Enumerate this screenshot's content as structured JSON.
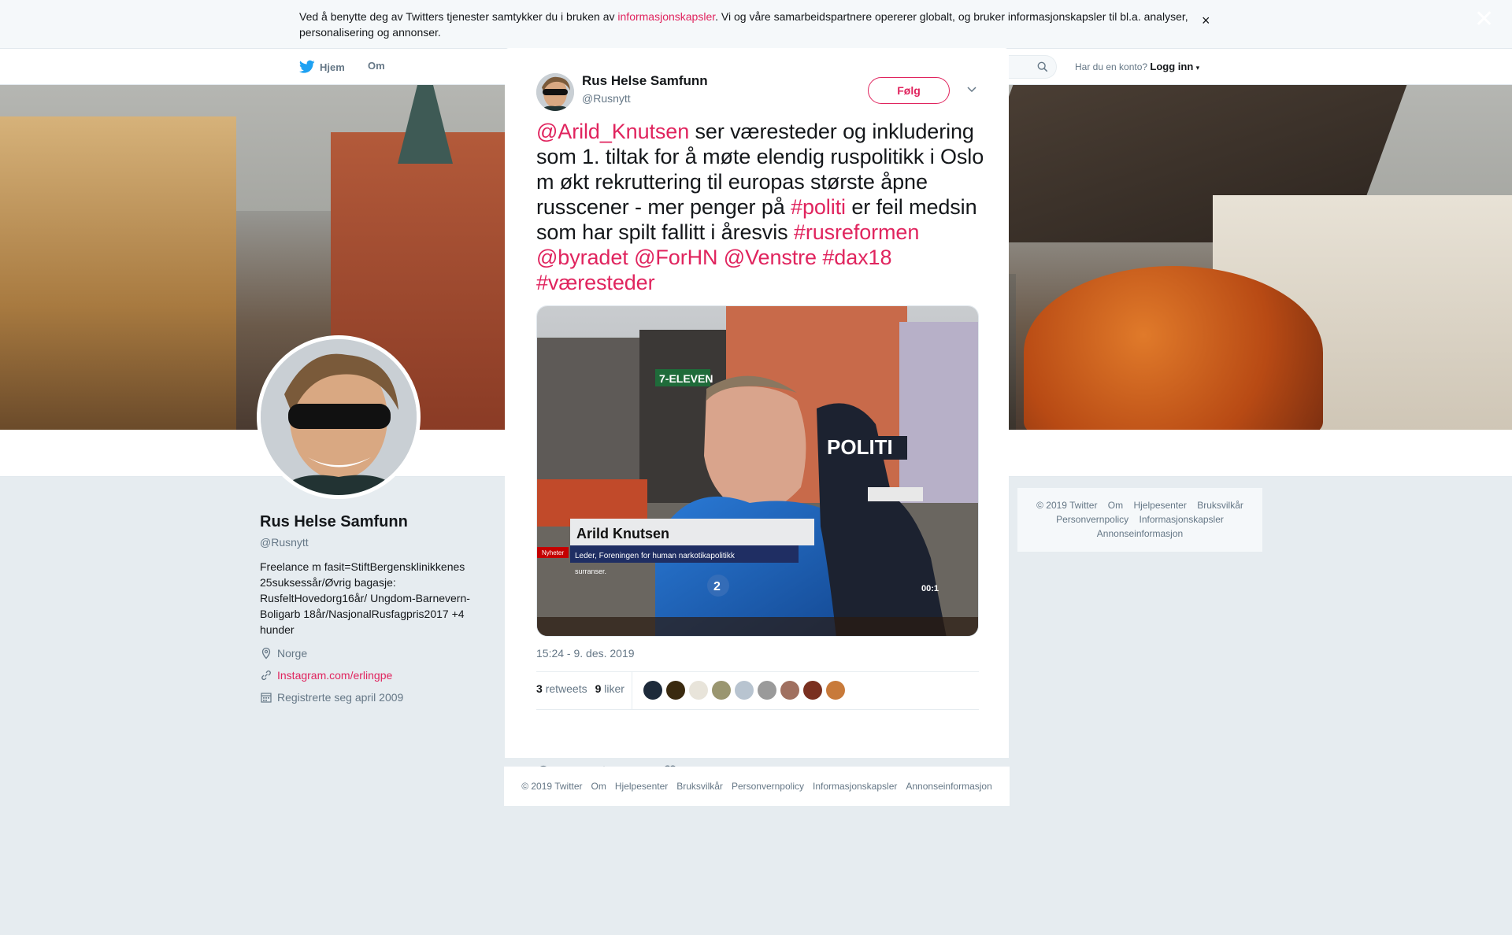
{
  "cookie_banner": {
    "text_before": "Ved å benytte deg av Twitters tjenester samtykker du i bruken av ",
    "link": "informasjonskapsler",
    "text_after": ". Vi og våre samarbeidspartnere opererer globalt, og bruker informasjonskapsler til bl.a. analyser, personalisering og annonser.",
    "close": "×"
  },
  "global_close": "✕",
  "nav": {
    "home": "Hjem",
    "about": "Om",
    "account_prompt": "Har du en konto?",
    "login": "Logg inn"
  },
  "profile": {
    "name": "Rus Helse Samfunn",
    "handle": "@Rusnytt",
    "bio": "Freelance m fasit=StiftBergensklinikkenes 25suksessår/Øvrig bagasje: RusfeltHovedorg16år/ Ungdom-Barnevern-Boligarb 18år/NasjonalRusfagpris2017 +4 hunder",
    "location": "Norge",
    "website": "Instagram.com/erlingpe",
    "joined": "Registrerte seg april 2009"
  },
  "right_footer": {
    "links": [
      "© 2019 Twitter",
      "Om",
      "Hjelpesenter",
      "Bruksvilkår",
      "Personvernpolicy",
      "Informasjonskapsler",
      "Annonseinformasjon"
    ]
  },
  "tweet": {
    "author_name": "Rus Helse Samfunn",
    "author_handle": "@Rusnytt",
    "follow_label": "Følg",
    "text_parts": [
      {
        "t": "@Arild_Knutsen",
        "tag": true
      },
      {
        "t": " ser væresteder og inkludering som 1. tiltak for å møte elendig ruspolitikk i Oslo m økt rekruttering til europas største åpne russcener - mer penger på ",
        "tag": false
      },
      {
        "t": "#politi",
        "tag": true
      },
      {
        "t": " er feil medsin som har spilt fallitt i åresvis ",
        "tag": false
      },
      {
        "t": "#rusreformen",
        "tag": true
      },
      {
        "t": " ",
        "tag": false
      },
      {
        "t": "@byradet",
        "tag": true
      },
      {
        "t": " ",
        "tag": false
      },
      {
        "t": "@ForHN",
        "tag": true
      },
      {
        "t": " ",
        "tag": false
      },
      {
        "t": "@Venstre",
        "tag": true
      },
      {
        "t": " ",
        "tag": false
      },
      {
        "t": "#dax18",
        "tag": true
      },
      {
        "t": " ",
        "tag": false
      },
      {
        "t": "#væresteder",
        "tag": true
      }
    ],
    "media": {
      "store_sign": "7-ELEVEN",
      "police_label": "POLITI",
      "lower_third_name": "Arild Knutsen",
      "lower_third_title": "Leder, Foreningen for human narkotikapolitikk",
      "lower_third_sub": "Nyheter",
      "lower_third_extra": "surranser.",
      "channel": "2",
      "timecode": "00:1"
    },
    "timestamp": "15:24 - 9. des. 2019",
    "retweets_count": "3",
    "retweets_label": "retweets",
    "likes_count": "9",
    "likes_label": "liker",
    "liker_avatars": [
      "#1d2a3a",
      "#3a2a10",
      "#e8e4da",
      "#9a9670",
      "#b8c4d0",
      "#9a9a9a",
      "#a07060",
      "#7a3020",
      "#c87a3a"
    ],
    "reply_count": "",
    "retweet_action_count": "3",
    "like_action_count": "9"
  },
  "modal_footer": {
    "links": [
      "© 2019 Twitter",
      "Om",
      "Hjelpesenter",
      "Bruksvilkår",
      "Personvernpolicy",
      "Informasjonskapsler",
      "Annonseinformasjon"
    ]
  },
  "colors": {
    "accent": "#e0245e",
    "muted": "#657786",
    "background": "#e6ecf0"
  }
}
